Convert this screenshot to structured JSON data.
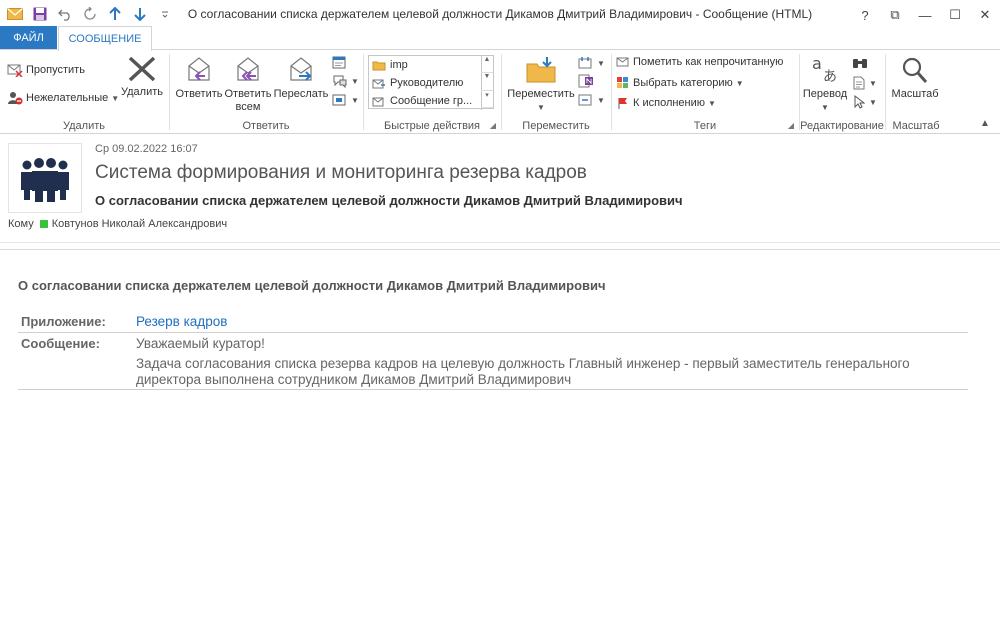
{
  "window": {
    "title": "О согласовании списка держателем целевой должности Дикамов Дмитрий Владимирович - Сообщение (HTML)",
    "controls": [
      "?",
      "⧉",
      "—",
      "☐",
      "✕"
    ]
  },
  "tabs": {
    "file": "ФАЙЛ",
    "message": "СООБЩЕНИЕ"
  },
  "ribbon": {
    "delete_group": {
      "label": "Удалить",
      "ignore": "Пропустить",
      "junk": "Нежелательные",
      "delete": "Удалить"
    },
    "respond_group": {
      "label": "Ответить",
      "reply": "Ответить",
      "reply_all_line1": "Ответить",
      "reply_all_line2": "всем",
      "forward": "Переслать"
    },
    "quick_steps": {
      "label": "Быстрые действия",
      "items": [
        "imp",
        "Руководителю",
        "Сообщение гр..."
      ]
    },
    "move_group": {
      "label": "Переместить",
      "move": "Переместить"
    },
    "tags_group": {
      "label": "Теги",
      "mark_unread": "Пометить как непрочитанную",
      "categorize": "Выбрать категорию",
      "follow_up": "К исполнению"
    },
    "editing_group": {
      "label": "Редактирование",
      "translate": "Перевод"
    },
    "zoom_group": {
      "label": "Масштаб",
      "zoom": "Масштаб"
    }
  },
  "header": {
    "date": "Ср 09.02.2022 16:07",
    "sender": "Система формирования и мониторинга резерва кадров",
    "subject": "О согласовании списка держателем целевой должности Дикамов Дмитрий Владимирович",
    "to_label": "Кому",
    "to_name": "Ковтунов Николай Александрович"
  },
  "body": {
    "title": "О согласовании списка держателем целевой должности Дикамов Дмитрий Владимирович",
    "app_label": "Приложение:",
    "app_value": "Резерв кадров",
    "msg_label": "Сообщение:",
    "greeting": "Уважаемый куратор!",
    "text_line1": "Задача согласования списка резерва кадров на целевую должность Главный инженер - первый заместитель генерального",
    "text_line2": "директора выполнена сотрудником Дикамов Дмитрий Владимирович"
  },
  "colors": {
    "accent": "#2b79c2",
    "link": "#1f6fbf",
    "presence": "#3ac03a"
  }
}
